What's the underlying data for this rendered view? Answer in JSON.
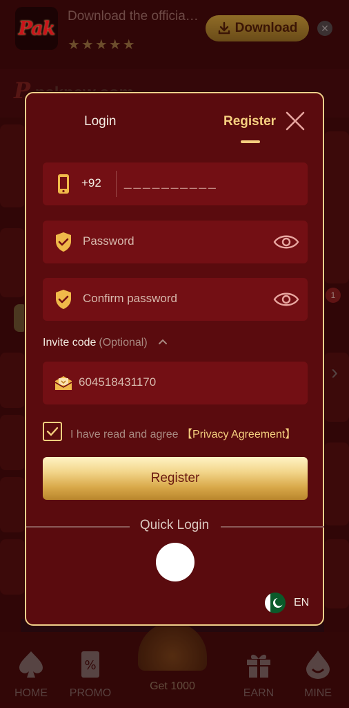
{
  "banner": {
    "logo_text": "Pak",
    "text": "Download the official app",
    "stars": "★★★★★",
    "download_label": "Download",
    "close_glyph": "✕"
  },
  "background": {
    "brand": "paknew.com",
    "badge_count": "1"
  },
  "modal": {
    "tabs": {
      "login": "Login",
      "register": "Register"
    },
    "phone": {
      "country_code": "+92",
      "placeholder": "__________"
    },
    "password": {
      "placeholder": "Password"
    },
    "confirm_password": {
      "placeholder": "Confirm password"
    },
    "invite": {
      "label": "Invite code",
      "optional": "(Optional)",
      "value": "604518431170"
    },
    "agreement": {
      "text": "I have read and agree",
      "link": "【Privacy Agreement】",
      "checked": true
    },
    "register_button": "Register",
    "quick_login": "Quick Login",
    "language": "EN"
  },
  "bottom_nav": {
    "items": [
      {
        "label": "HOME",
        "icon": "spade-icon"
      },
      {
        "label": "PROMO",
        "icon": "coupon-icon"
      },
      {
        "label": "Get 1000",
        "icon": "wheel-icon"
      },
      {
        "label": "EARN",
        "icon": "gift-icon"
      },
      {
        "label": "MINE",
        "icon": "user-drop-icon"
      }
    ]
  },
  "colors": {
    "accent_gold": "#f5cf7f",
    "modal_bg": "#5a0b0e",
    "field_bg": "#730f14",
    "page_bg": "#3a0708"
  }
}
